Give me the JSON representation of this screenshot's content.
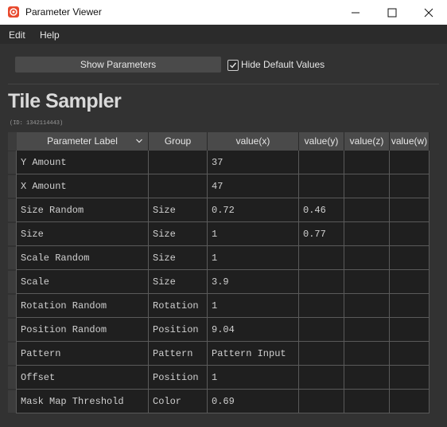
{
  "window": {
    "title": "Parameter Viewer",
    "accent_color": "#e84a2e"
  },
  "menu": {
    "items": [
      "Edit",
      "Help"
    ]
  },
  "toolbar": {
    "show_button_label": "Show Parameters",
    "hide_defaults_label": "Hide Default Values",
    "hide_defaults_checked": true
  },
  "node": {
    "name": "Tile Sampler",
    "id_text": "(ID: 1342114443)"
  },
  "table": {
    "headers": [
      "Parameter Label",
      "Group",
      "value(x)",
      "value(y)",
      "value(z)",
      "value(w)"
    ],
    "rows": [
      [
        "Y Amount",
        "",
        "37",
        "",
        "",
        ""
      ],
      [
        "X Amount",
        "",
        "47",
        "",
        "",
        ""
      ],
      [
        "Size Random",
        "Size",
        "0.72",
        "0.46",
        "",
        ""
      ],
      [
        "Size",
        "Size",
        "1",
        "0.77",
        "",
        ""
      ],
      [
        "Scale Random",
        "Size",
        "1",
        "",
        "",
        ""
      ],
      [
        "Scale",
        "Size",
        "3.9",
        "",
        "",
        ""
      ],
      [
        "Rotation Random",
        "Rotation",
        "1",
        "",
        "",
        ""
      ],
      [
        "Position Random",
        "Position",
        "9.04",
        "",
        "",
        ""
      ],
      [
        "Pattern",
        "Pattern",
        "Pattern Input",
        "",
        "",
        ""
      ],
      [
        "Offset",
        "Position",
        "1",
        "",
        "",
        ""
      ],
      [
        "Mask Map Threshold",
        "Color",
        "0.69",
        "",
        "",
        ""
      ]
    ]
  }
}
